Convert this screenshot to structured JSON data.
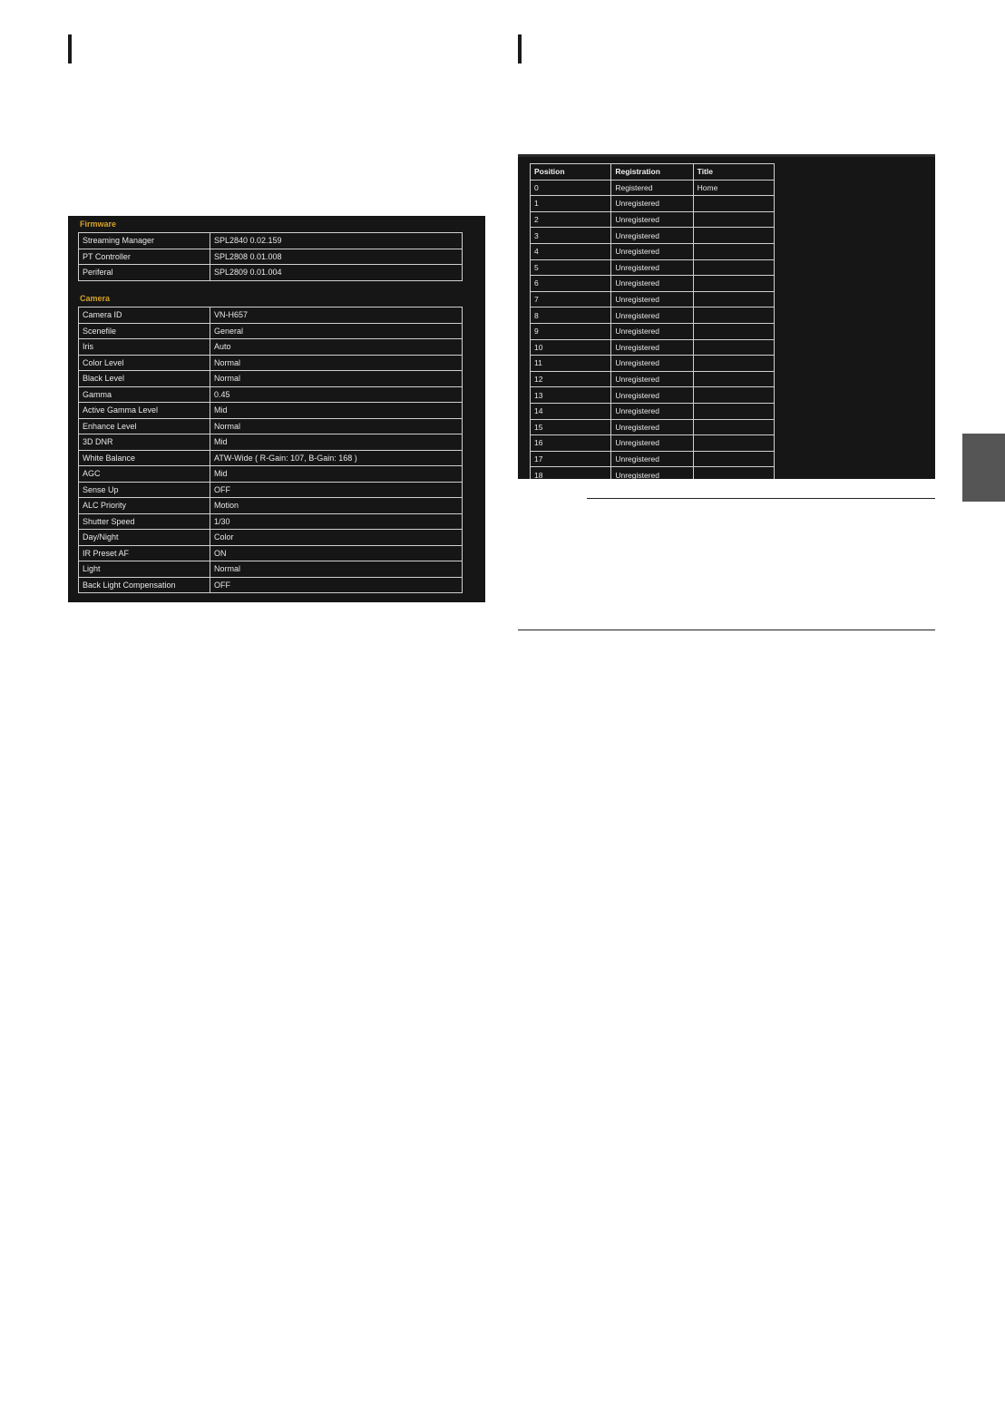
{
  "status": {
    "firmware_title": "Firmware",
    "firmware_rows": [
      {
        "label": "Streaming Manager",
        "value": "SPL2840 0.02.159"
      },
      {
        "label": "PT Controller",
        "value": "SPL2808 0.01.008"
      },
      {
        "label": "Periferal",
        "value": "SPL2809 0.01.004"
      }
    ],
    "camera_title": "Camera",
    "camera_rows": [
      {
        "label": "Camera ID",
        "value": "VN-H657"
      },
      {
        "label": "Scenefile",
        "value": "General"
      },
      {
        "label": "Iris",
        "value": "Auto"
      },
      {
        "label": "Color Level",
        "value": "Normal"
      },
      {
        "label": "Black Level",
        "value": "Normal"
      },
      {
        "label": "Gamma",
        "value": "0.45"
      },
      {
        "label": "Active Gamma Level",
        "value": "Mid"
      },
      {
        "label": "Enhance Level",
        "value": "Normal"
      },
      {
        "label": "3D DNR",
        "value": "Mid"
      },
      {
        "label": "White Balance",
        "value": "ATW-Wide    ( R-Gain: 107, B-Gain: 168 )"
      },
      {
        "label": "AGC",
        "value": "Mid"
      },
      {
        "label": "Sense Up",
        "value": "OFF"
      },
      {
        "label": "ALC Priority",
        "value": "Motion"
      },
      {
        "label": "Shutter Speed",
        "value": "1/30"
      },
      {
        "label": "Day/Night",
        "value": "Color"
      },
      {
        "label": "IR Preset AF",
        "value": "ON"
      },
      {
        "label": "Light",
        "value": "Normal"
      },
      {
        "label": "Back Light Compensation",
        "value": "OFF"
      }
    ]
  },
  "preset": {
    "headers": {
      "position": "Position",
      "registration": "Registration",
      "title": "Title"
    },
    "rows": [
      {
        "position": "0",
        "registration": "Registered",
        "title": "Home"
      },
      {
        "position": "1",
        "registration": "Unregistered",
        "title": ""
      },
      {
        "position": "2",
        "registration": "Unregistered",
        "title": ""
      },
      {
        "position": "3",
        "registration": "Unregistered",
        "title": ""
      },
      {
        "position": "4",
        "registration": "Unregistered",
        "title": ""
      },
      {
        "position": "5",
        "registration": "Unregistered",
        "title": ""
      },
      {
        "position": "6",
        "registration": "Unregistered",
        "title": ""
      },
      {
        "position": "7",
        "registration": "Unregistered",
        "title": ""
      },
      {
        "position": "8",
        "registration": "Unregistered",
        "title": ""
      },
      {
        "position": "9",
        "registration": "Unregistered",
        "title": ""
      },
      {
        "position": "10",
        "registration": "Unregistered",
        "title": ""
      },
      {
        "position": "11",
        "registration": "Unregistered",
        "title": ""
      },
      {
        "position": "12",
        "registration": "Unregistered",
        "title": ""
      },
      {
        "position": "13",
        "registration": "Unregistered",
        "title": ""
      },
      {
        "position": "14",
        "registration": "Unregistered",
        "title": ""
      },
      {
        "position": "15",
        "registration": "Unregistered",
        "title": ""
      },
      {
        "position": "16",
        "registration": "Unregistered",
        "title": ""
      },
      {
        "position": "17",
        "registration": "Unregistered",
        "title": ""
      },
      {
        "position": "18",
        "registration": "Unregistered",
        "title": ""
      }
    ]
  },
  "colors": {
    "panel_background": "#161616",
    "section_title": "#d4a22a",
    "table_border": "#d0d0d0",
    "side_tab": "#555555"
  }
}
